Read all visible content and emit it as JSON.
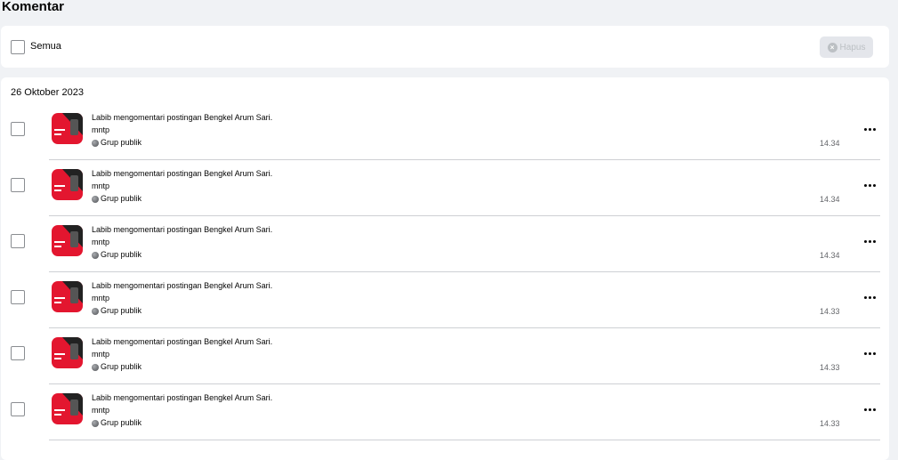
{
  "page_title": "Komentar",
  "toolbar": {
    "select_all_label": "Semua",
    "delete_label": "Hapus",
    "delete_icon": "close-circle-icon"
  },
  "date_group": "26 Oktober 2023",
  "colors": {
    "background": "#f0f2f5",
    "card": "#ffffff",
    "thumbnail_red": "#e3162f",
    "thumbnail_dark": "#222222",
    "muted_text": "#65676b",
    "disabled_button": "#e4e6eb"
  },
  "items": [
    {
      "title": "Labib mengomentari postingan Bengkel Arum Sari.",
      "comment": "mntp",
      "audience": "Grup publik",
      "audience_icon": "globe-icon",
      "time": "14.34",
      "menu_icon": "more-horizontal-icon"
    },
    {
      "title": "Labib mengomentari postingan Bengkel Arum Sari.",
      "comment": "mntp",
      "audience": "Grup publik",
      "audience_icon": "globe-icon",
      "time": "14.34",
      "menu_icon": "more-horizontal-icon"
    },
    {
      "title": "Labib mengomentari postingan Bengkel Arum Sari.",
      "comment": "mntp",
      "audience": "Grup publik",
      "audience_icon": "globe-icon",
      "time": "14.34",
      "menu_icon": "more-horizontal-icon"
    },
    {
      "title": "Labib mengomentari postingan Bengkel Arum Sari.",
      "comment": "mntp",
      "audience": "Grup publik",
      "audience_icon": "globe-icon",
      "time": "14.33",
      "menu_icon": "more-horizontal-icon"
    },
    {
      "title": "Labib mengomentari postingan Bengkel Arum Sari.",
      "comment": "mntp",
      "audience": "Grup publik",
      "audience_icon": "globe-icon",
      "time": "14.33",
      "menu_icon": "more-horizontal-icon"
    },
    {
      "title": "Labib mengomentari postingan Bengkel Arum Sari.",
      "comment": "mntp",
      "audience": "Grup publik",
      "audience_icon": "globe-icon",
      "time": "14.33",
      "menu_icon": "more-horizontal-icon"
    }
  ]
}
